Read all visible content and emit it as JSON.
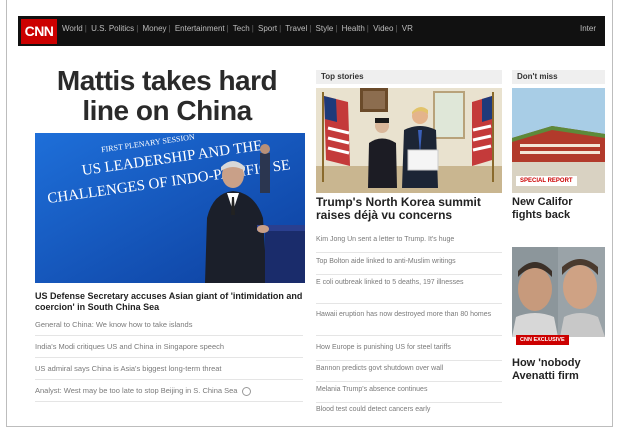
{
  "brand": {
    "logo_text": "CNN",
    "color": "#cc0000"
  },
  "nav": {
    "items": [
      "World",
      "U.S. Politics",
      "Money",
      "Entertainment",
      "Tech",
      "Sport",
      "Travel",
      "Style",
      "Health",
      "Video",
      "VR"
    ],
    "right_label": "Inter"
  },
  "main": {
    "headline": "Mattis takes hard line on China",
    "hero_banner": [
      "FIRST PLENARY SESSION",
      "US LEADERSHIP AND THE",
      "CHALLENGES OF INDO-PACIFIC SE"
    ],
    "lead_story": "US Defense Secretary accuses Asian giant of 'intimidation and coercion' in South China Sea",
    "related": [
      "General to China: We know how to take islands",
      "India's Modi critiques US and China in Singapore speech",
      "US admiral says China is Asia's biggest long-term threat",
      "Analyst: West may be too late to stop Beijing in S. China Sea"
    ]
  },
  "top_stories": {
    "section_title": "Top stories",
    "title": "Trump's North Korea summit raises déjà vu concerns",
    "items": [
      "Kim Jong Un sent a letter to Trump. It's huge",
      "Top Bolton aide linked to anti-Muslim writings",
      "E coli outbreak linked to 5 deaths, 197 illnesses",
      "Hawaii eruption has now destroyed more than 80 homes",
      "How Europe is punishing US for steel tariffs",
      "Bannon predicts govt shutdown over wall",
      "Melania Trump's absence continues",
      "Blood test could detect cancers early"
    ]
  },
  "dont_miss": {
    "section_title": "Don't miss",
    "card1": {
      "badge": "SPECIAL REPORT",
      "title": [
        "New Califor",
        "fights back"
      ]
    },
    "card2": {
      "badge": "CNN EXCLUSIVE",
      "title": [
        "How 'nobody",
        "Avenatti firm"
      ]
    }
  }
}
